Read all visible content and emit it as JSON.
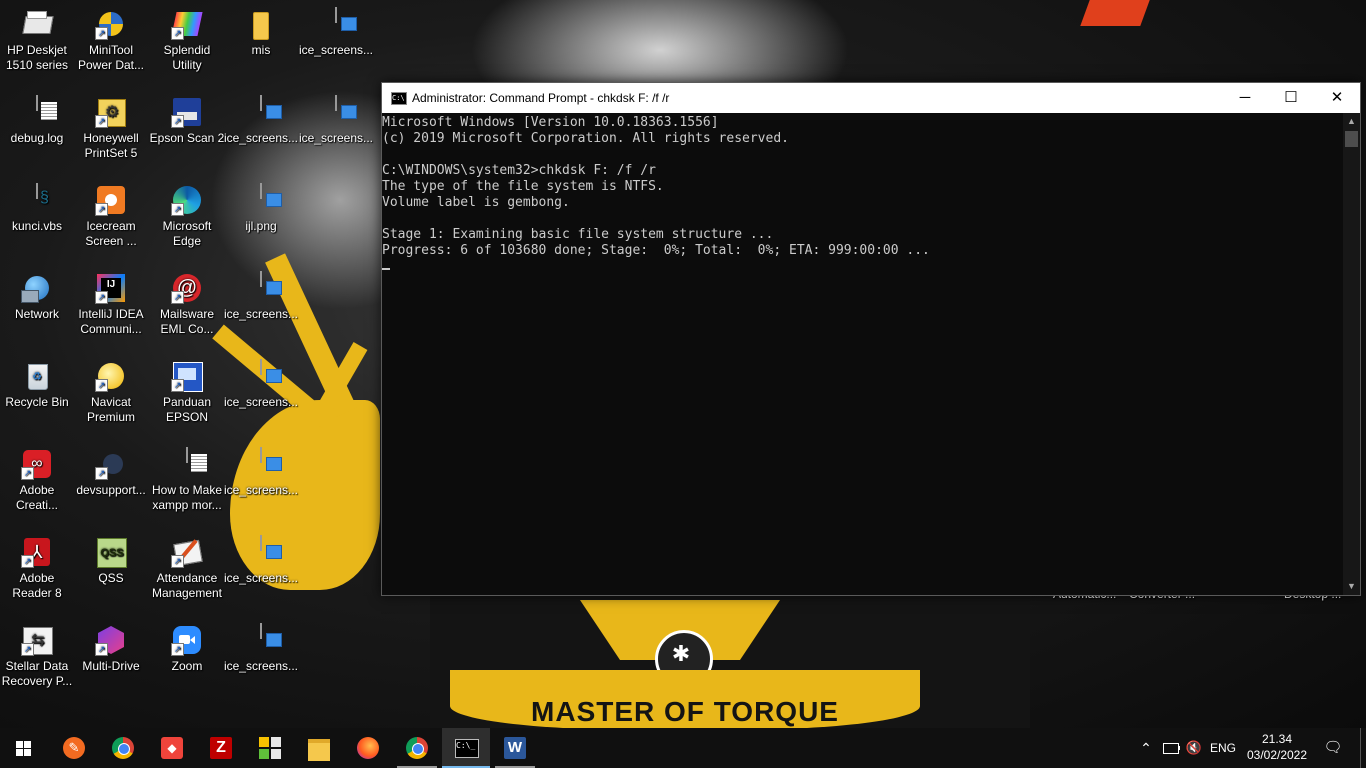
{
  "desktop": {
    "icons": [
      {
        "label": "HP Deskjet\n1510 series"
      },
      {
        "label": "MiniTool\nPower Dat..."
      },
      {
        "label": "Splendid\nUtility"
      },
      {
        "label": "mis"
      },
      {
        "label": "ice_screens..."
      },
      {
        "label": "debug.log"
      },
      {
        "label": "Honeywell\nPrintSet 5"
      },
      {
        "label": "Epson Scan 2"
      },
      {
        "label": "ice_screens..."
      },
      {
        "label": "ice_screens..."
      },
      {
        "label": "kunci.vbs"
      },
      {
        "label": "Icecream\nScreen ..."
      },
      {
        "label": "Microsoft\nEdge"
      },
      {
        "label": "ijl.png"
      },
      {
        "label": "Network"
      },
      {
        "label": "IntelliJ IDEA\nCommuni..."
      },
      {
        "label": "Mailsware\nEML Co..."
      },
      {
        "label": "ice_screens..."
      },
      {
        "label": "Recycle Bin"
      },
      {
        "label": "Navicat\nPremium"
      },
      {
        "label": "Panduan\nEPSON"
      },
      {
        "label": "ice_screens..."
      },
      {
        "label": "Adobe\nCreati..."
      },
      {
        "label": "devsupport..."
      },
      {
        "label": "How to Make\nxampp mor..."
      },
      {
        "label": "ice_screens..."
      },
      {
        "label": "Adobe\nReader 8"
      },
      {
        "label": "QSS"
      },
      {
        "label": "Attendance\nManagement"
      },
      {
        "label": "ice_screens..."
      },
      {
        "label": "Stellar Data\nRecovery P..."
      },
      {
        "label": "Multi-Drive"
      },
      {
        "label": "Zoom"
      },
      {
        "label": "ice_screens..."
      }
    ],
    "peek_labels": [
      "Automatic...",
      "Converter ...",
      "Desktop ..."
    ],
    "wallpaper_text": "MASTER OF TORQUE INDONESIA"
  },
  "cmd": {
    "title": "Administrator: Command Prompt - chkdsk  F: /f /r",
    "icon_text": "C:\\",
    "minimize": "─",
    "maximize": "☐",
    "close": "✕",
    "lines": [
      "Microsoft Windows [Version 10.0.18363.1556]",
      "(c) 2019 Microsoft Corporation. All rights reserved.",
      "",
      "C:\\WINDOWS\\system32>chkdsk F: /f /r",
      "The type of the file system is NTFS.",
      "Volume label is gembong.",
      "",
      "Stage 1: Examining basic file system structure ...",
      "Progress: 6 of 103680 done; Stage:  0%; Total:  0%; ETA: 999:00:00 ..."
    ],
    "scroll_up": "▲",
    "scroll_down": "▼"
  },
  "taskbar": {
    "items": [
      "start",
      "marker",
      "chrome",
      "anydesk",
      "filezilla",
      "app-grid",
      "file-explorer",
      "firefox",
      "chrome-canary",
      "command-prompt",
      "word"
    ],
    "tray": {
      "chevron": "⌃",
      "language": "ENG",
      "time": "21.34",
      "date": "03/02/2022"
    }
  },
  "colors": {
    "console_bg": "#0c0c0c",
    "console_text": "#cccccc",
    "taskbar_bg": "#101010",
    "accent": "#76b9ed",
    "wallpaper_gold": "#e8b71a"
  }
}
